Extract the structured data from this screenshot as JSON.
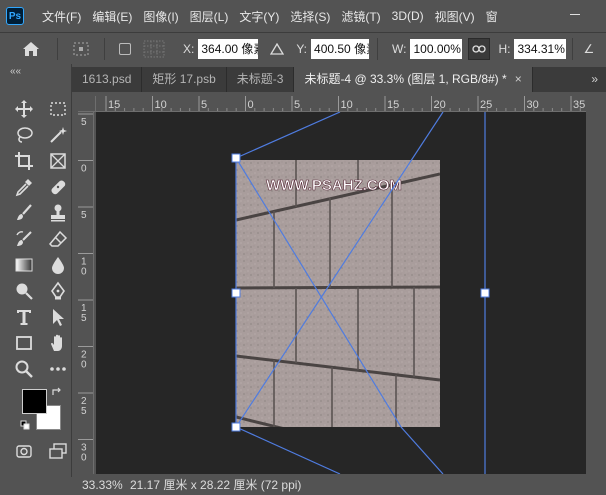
{
  "menu": {
    "logo": "Ps",
    "items": [
      "文件(F)",
      "编辑(E)",
      "图像(I)",
      "图层(L)",
      "文字(Y)",
      "选择(S)",
      "滤镜(T)",
      "3D(D)",
      "视图(V)",
      "窗"
    ]
  },
  "options": {
    "x_label": "X:",
    "x_value": "364.00 像素",
    "y_label": "Y:",
    "y_value": "400.50 像素",
    "w_label": "W:",
    "w_value": "100.00%",
    "h_label": "H:",
    "h_value": "334.31%",
    "angle_label": "∠"
  },
  "tabs": [
    {
      "label": "1613.psd",
      "active": false
    },
    {
      "label": "矩形 17.psb",
      "active": false
    },
    {
      "label": "未标题-3",
      "active": false
    },
    {
      "label": "未标题-4 @ 33.3% (图层 1, RGB/8#) *",
      "active": true
    }
  ],
  "tab_close": "×",
  "tab_more": "»",
  "collapse_label": "««",
  "ruler": {
    "h_labels": [
      "15",
      "10",
      "5",
      "0",
      "5",
      "10",
      "15",
      "20",
      "25",
      "30",
      "35"
    ],
    "v_labels": [
      "5",
      "0",
      "5",
      "1\n0",
      "1\n5",
      "2\n0",
      "2\n5",
      "3\n0"
    ]
  },
  "canvas_image": {
    "watermark": "WWW.PSAHZ.COM"
  },
  "status": {
    "zoom": "33.33%",
    "doc_info": "21.17 厘米 x 28.22 厘米 (72 ppi)"
  },
  "colors": {
    "foreground": "#000000",
    "background": "#ffffff",
    "guide": "#4f7ce0",
    "accent": "#31a8ff"
  }
}
